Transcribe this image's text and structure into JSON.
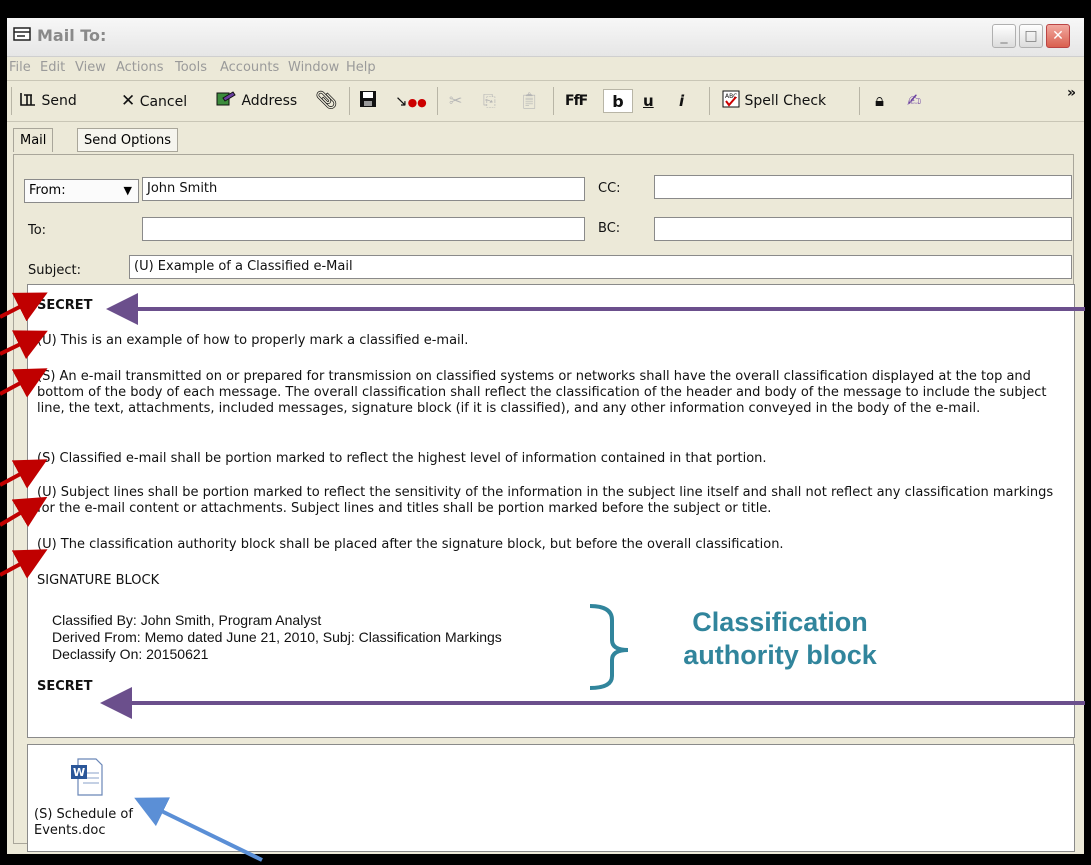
{
  "window": {
    "title": "Mail To:"
  },
  "menu": [
    "File",
    "Edit",
    "View",
    "Actions",
    "Tools",
    "Accounts",
    "Window",
    "Help"
  ],
  "toolbar": {
    "send": "Send",
    "cancel": "Cancel",
    "address": "Address",
    "bold": "b",
    "underline": "u",
    "italic": "i",
    "spell_check": "Spell Check",
    "more": "»"
  },
  "tabs": {
    "mail": "Mail",
    "send_options": "Send Options"
  },
  "header": {
    "from_label": "From:",
    "from_value": "John Smith",
    "to_label": "To:",
    "to_value": "",
    "cc_label": "CC:",
    "cc_value": "",
    "bc_label": "BC:",
    "bc_value": "",
    "subject_label": "Subject:",
    "subject_value": "(U) Example of a Classified e-Mail"
  },
  "body": {
    "banner_top": "SECRET",
    "paragraphs": [
      "(U) This is an example of how to properly mark a classified e-mail.",
      "(S) An e-mail transmitted on or prepared for transmission on classified systems or networks shall have the overall classification displayed at the top and bottom of the body of each message.  The overall classification shall reflect the classification of the header and body of the message to include the subject line, the text, attachments, included messages, signature block (if it is classified), and any other information conveyed in the body of the e-mail.",
      "(S) Classified e-mail shall be portion marked to reflect the highest level of information contained in that portion.",
      "(U) Subject lines shall be portion marked to reflect the sensitivity of the information in the subject line itself and shall not reflect any classification markings for the e-mail content or attachments.  Subject lines and titles shall be portion marked before the subject or title.",
      "(U) The classification authority block shall be placed after the signature block, but before the overall classification."
    ],
    "signature": "SIGNATURE BLOCK",
    "classified_by": "Classified By:  John Smith, Program Analyst",
    "derived_from": "Derived From:   Memo dated June 21, 2010, Subj:  Classification Markings",
    "declassify_on": "Declassify On:  20150621",
    "banner_bottom": "SECRET"
  },
  "attachment": {
    "icon": "word-document-icon",
    "name": "(S) Schedule of Events.doc"
  },
  "annotation": {
    "callout": "Classification authority block",
    "callout_color": "#31859c",
    "arrow_red": "#c00000",
    "arrow_purple": "#6b4f8c",
    "arrow_blue": "#5b8fd6"
  }
}
